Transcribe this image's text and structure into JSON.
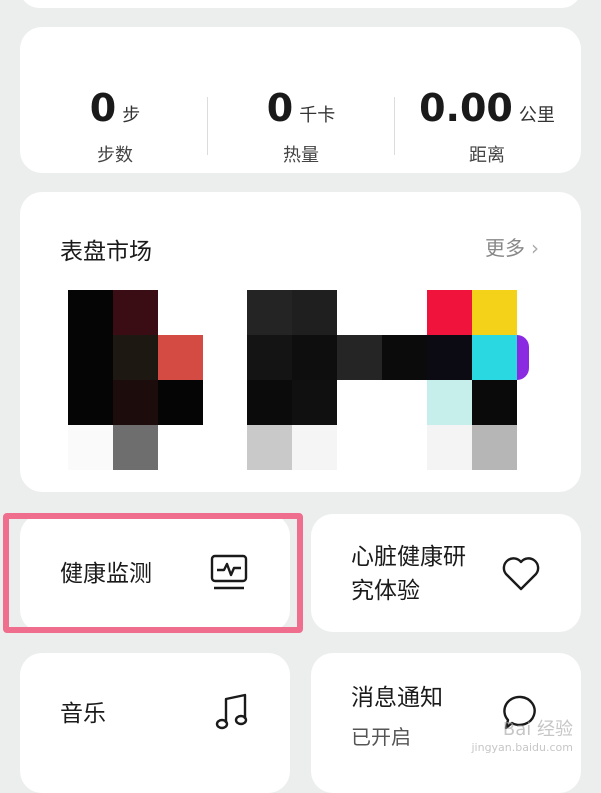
{
  "stats": {
    "steps": {
      "value": "0",
      "unit": "步",
      "label": "步数"
    },
    "calories": {
      "value": "0",
      "unit": "千卡",
      "label": "热量"
    },
    "distance": {
      "value": "0.00",
      "unit": "公里",
      "label": "距离"
    }
  },
  "watch_faces": {
    "title": "表盘市场",
    "more_label": "更多"
  },
  "features": {
    "health_monitor": {
      "label": "健康监测",
      "icon": "heart-rate-monitor-icon"
    },
    "heart_study": {
      "label_line1": "心脏健康研",
      "label_line2": "究体验",
      "icon": "heart-icon"
    },
    "music": {
      "label": "音乐",
      "icon": "music-note-icon"
    },
    "notifications": {
      "label": "消息通知",
      "status": "已开启",
      "icon": "chat-bubble-icon"
    }
  },
  "watermark": {
    "brand": "Bai 经验",
    "url": "jingyan.baidu.com"
  },
  "colors": {
    "highlight": "#ef6e8e",
    "background": "#eceded",
    "card": "#ffffff"
  }
}
